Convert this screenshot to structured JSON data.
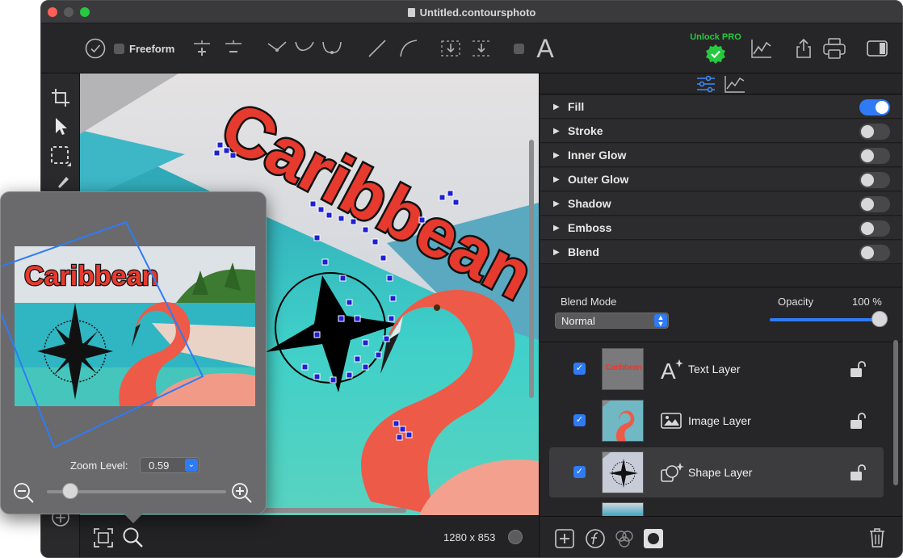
{
  "window": {
    "title": "Untitled.contoursphoto",
    "traffic_lights": {
      "close": "#fe5f57",
      "minimize": "#5a5a5c",
      "zoom": "#28c840"
    }
  },
  "toolbar": {
    "freeform_label": "Freeform",
    "freeform_checked": false,
    "unlock_label": "Unlock PRO",
    "unlock_color": "#27c93f",
    "text_tool_glyph": "A"
  },
  "canvas": {
    "headline_text": "Caribbean",
    "image_size": "1280 x 853"
  },
  "effects": {
    "items": [
      {
        "label": "Fill",
        "on": true
      },
      {
        "label": "Stroke",
        "on": false
      },
      {
        "label": "Inner Glow",
        "on": false
      },
      {
        "label": "Outer Glow",
        "on": false
      },
      {
        "label": "Shadow",
        "on": false
      },
      {
        "label": "Emboss",
        "on": false
      },
      {
        "label": "Blend",
        "on": false
      }
    ]
  },
  "blend": {
    "mode_label": "Blend Mode",
    "mode_value": "Normal",
    "opacity_label": "Opacity",
    "opacity_value": "100 %",
    "opacity_fraction": 1.0
  },
  "layers": {
    "items": [
      {
        "name": "Text Layer",
        "visible": true,
        "thumb_text": "Caribbean",
        "icon": "text-layer-icon"
      },
      {
        "name": "Image Layer",
        "visible": true,
        "icon": "image-layer-icon"
      },
      {
        "name": "Shape Layer",
        "visible": true,
        "icon": "shape-layer-icon",
        "selected": true
      }
    ]
  },
  "navigator": {
    "preview_text": "Caribbean",
    "zoom_label": "Zoom Level:",
    "zoom_value": "0.59",
    "zoom_fraction": 0.14
  },
  "colors": {
    "accent": "#2f7bf5",
    "headline_red": "#e63a2e",
    "handle_blue": "#1f1fd6"
  }
}
